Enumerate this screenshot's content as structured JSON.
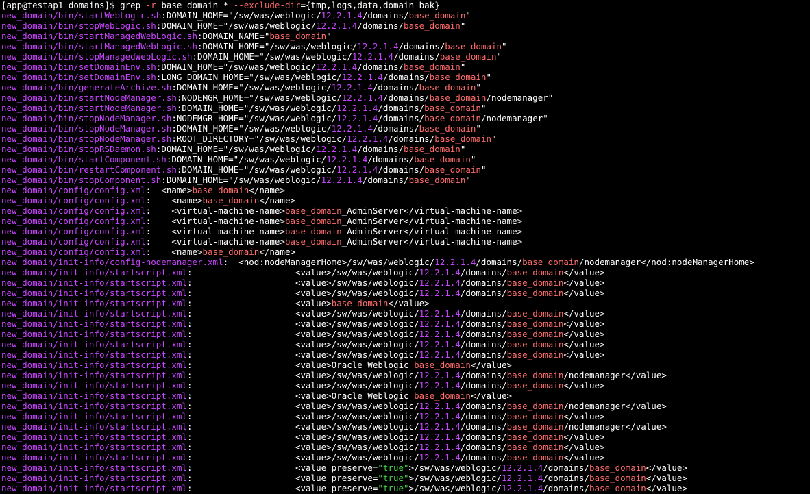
{
  "terminal": {
    "prompt": "[app@testap1 domains]$ ",
    "command_start": "grep ",
    "command_flag_r": "-r",
    "command_mid": " base_domain * ",
    "command_flag_ex": "--exclude-dir",
    "command_end": "={tmp,logs,data,domain_bak}",
    "colors": {
      "background": "#000000",
      "foreground": "#ffffff",
      "filename": "#c845ff",
      "match": "#ff6b6b",
      "string_literal": "#46d146"
    }
  },
  "lines": [
    {
      "file": "new_domain/bin/startWebLogic.sh",
      "pre": "DOMAIN_HOME=\"/sw/was/weblogic/",
      "ver": "12.2.1.4",
      "mid": "/domains/",
      "match": "base_domain",
      "post": "\""
    },
    {
      "file": "new_domain/bin/stopWebLogic.sh",
      "pre": "DOMAIN_HOME=\"/sw/was/weblogic/",
      "ver": "12.2.1.4",
      "mid": "/domains/",
      "match": "base_domain",
      "post": "\""
    },
    {
      "file": "new_domain/bin/startManagedWebLogic.sh",
      "pre": "DOMAIN_NAME=\"",
      "ver": "",
      "mid": "",
      "match": "base_domain",
      "post": "\""
    },
    {
      "file": "new_domain/bin/startManagedWebLogic.sh",
      "pre": "DOMAIN_HOME=\"/sw/was/weblogic/",
      "ver": "12.2.1.4",
      "mid": "/domains/",
      "match": "base_domain",
      "post": "\""
    },
    {
      "file": "new_domain/bin/stopManagedWebLogic.sh",
      "pre": "DOMAIN_HOME=\"/sw/was/weblogic/",
      "ver": "12.2.1.4",
      "mid": "/domains/",
      "match": "base_domain",
      "post": "\""
    },
    {
      "file": "new_domain/bin/setDomainEnv.sh",
      "pre": "DOMAIN_HOME=\"/sw/was/weblogic/",
      "ver": "12.2.1.4",
      "mid": "/domains/",
      "match": "base_domain",
      "post": "\""
    },
    {
      "file": "new_domain/bin/setDomainEnv.sh",
      "pre": "LONG_DOMAIN_HOME=\"/sw/was/weblogic/",
      "ver": "12.2.1.4",
      "mid": "/domains/",
      "match": "base_domain",
      "post": "\""
    },
    {
      "file": "new_domain/bin/generateArchive.sh",
      "pre": "DOMAIN_HOME=\"/sw/was/weblogic/",
      "ver": "12.2.1.4",
      "mid": "/domains/",
      "match": "base_domain",
      "post": "\""
    },
    {
      "file": "new_domain/bin/startNodeManager.sh",
      "pre": "NODEMGR_HOME=\"/sw/was/weblogic/",
      "ver": "12.2.1.4",
      "mid": "/domains/",
      "match": "base_domain",
      "post": "/nodemanager\""
    },
    {
      "file": "new_domain/bin/startNodeManager.sh",
      "pre": "DOMAIN_HOME=\"/sw/was/weblogic/",
      "ver": "12.2.1.4",
      "mid": "/domains/",
      "match": "base_domain",
      "post": "\""
    },
    {
      "file": "new_domain/bin/stopNodeManager.sh",
      "pre": "NODEMGR_HOME=\"/sw/was/weblogic/",
      "ver": "12.2.1.4",
      "mid": "/domains/",
      "match": "base_domain",
      "post": "/nodemanager\""
    },
    {
      "file": "new_domain/bin/stopNodeManager.sh",
      "pre": "DOMAIN_HOME=\"/sw/was/weblogic/",
      "ver": "12.2.1.4",
      "mid": "/domains/",
      "match": "base_domain",
      "post": "\""
    },
    {
      "file": "new_domain/bin/stopNodeManager.sh",
      "pre": "ROOT_DIRECTORY=\"/sw/was/weblogic/",
      "ver": "12.2.1.4",
      "mid": "/domains/",
      "match": "base_domain",
      "post": "\""
    },
    {
      "file": "new_domain/bin/stopRSDaemon.sh",
      "pre": "DOMAIN_HOME=\"/sw/was/weblogic/",
      "ver": "12.2.1.4",
      "mid": "/domains/",
      "match": "base_domain",
      "post": "\""
    },
    {
      "file": "new_domain/bin/startComponent.sh",
      "pre": "DOMAIN_HOME=\"/sw/was/weblogic/",
      "ver": "12.2.1.4",
      "mid": "/domains/",
      "match": "base_domain",
      "post": "\""
    },
    {
      "file": "new_domain/bin/restartComponent.sh",
      "pre": "DOMAIN_HOME=\"/sw/was/weblogic/",
      "ver": "12.2.1.4",
      "mid": "/domains/",
      "match": "base_domain",
      "post": "\""
    },
    {
      "file": "new_domain/bin/stopComponent.sh",
      "pre": "DOMAIN_HOME=\"/sw/was/weblogic/",
      "ver": "12.2.1.4",
      "mid": "/domains/",
      "match": "base_domain",
      "post": "\""
    },
    {
      "file": "new_domain/config/config.xml",
      "pre": "  <name>",
      "ver": "",
      "mid": "",
      "match": "base_domain",
      "post": "</name>"
    },
    {
      "file": "new_domain/config/config.xml",
      "pre": "    <name>",
      "ver": "",
      "mid": "",
      "match": "base_domain",
      "post": "</name>"
    },
    {
      "file": "new_domain/config/config.xml",
      "pre": "    <virtual-machine-name>",
      "ver": "",
      "mid": "",
      "match": "base_domain",
      "post": "_AdminServer</virtual-machine-name>"
    },
    {
      "file": "new_domain/config/config.xml",
      "pre": "    <virtual-machine-name>",
      "ver": "",
      "mid": "",
      "match": "base_domain",
      "post": "_AdminServer</virtual-machine-name>"
    },
    {
      "file": "new_domain/config/config.xml",
      "pre": "    <virtual-machine-name>",
      "ver": "",
      "mid": "",
      "match": "base_domain",
      "post": "_AdminServer</virtual-machine-name>"
    },
    {
      "file": "new_domain/config/config.xml",
      "pre": "    <virtual-machine-name>",
      "ver": "",
      "mid": "",
      "match": "base_domain",
      "post": "_AdminServer</virtual-machine-name>"
    },
    {
      "file": "new_domain/config/config.xml",
      "pre": "    <name>",
      "ver": "",
      "mid": "",
      "match": "base_domain",
      "post": "</name>"
    },
    {
      "file": "new_domain/init-info/config-nodemanager.xml",
      "pre": "  <nod:nodeManagerHome>/sw/was/weblogic/",
      "ver": "12.2.1.4",
      "mid": "/domains/",
      "match": "base_domain",
      "post": "/nodemanager</nod:nodeManagerHome>"
    },
    {
      "file": "new_domain/init-info/startscript.xml",
      "pre": "                    <value>/sw/was/weblogic/",
      "ver": "12.2.1.4",
      "mid": "/domains/",
      "match": "base_domain",
      "post": "</value>"
    },
    {
      "file": "new_domain/init-info/startscript.xml",
      "pre": "                    <value>/sw/was/weblogic/",
      "ver": "12.2.1.4",
      "mid": "/domains/",
      "match": "base_domain",
      "post": "</value>"
    },
    {
      "file": "new_domain/init-info/startscript.xml",
      "pre": "                    <value>/sw/was/weblogic/",
      "ver": "12.2.1.4",
      "mid": "/domains/",
      "match": "base_domain",
      "post": "</value>"
    },
    {
      "file": "new_domain/init-info/startscript.xml",
      "pre": "                    <value>",
      "ver": "",
      "mid": "",
      "match": "base_domain",
      "post": "</value>"
    },
    {
      "file": "new_domain/init-info/startscript.xml",
      "pre": "                    <value>/sw/was/weblogic/",
      "ver": "12.2.1.4",
      "mid": "/domains/",
      "match": "base_domain",
      "post": "</value>"
    },
    {
      "file": "new_domain/init-info/startscript.xml",
      "pre": "                    <value>/sw/was/weblogic/",
      "ver": "12.2.1.4",
      "mid": "/domains/",
      "match": "base_domain",
      "post": "</value>"
    },
    {
      "file": "new_domain/init-info/startscript.xml",
      "pre": "                    <value>/sw/was/weblogic/",
      "ver": "12.2.1.4",
      "mid": "/domains/",
      "match": "base_domain",
      "post": "</value>"
    },
    {
      "file": "new_domain/init-info/startscript.xml",
      "pre": "                    <value>/sw/was/weblogic/",
      "ver": "12.2.1.4",
      "mid": "/domains/",
      "match": "base_domain",
      "post": "</value>"
    },
    {
      "file": "new_domain/init-info/startscript.xml",
      "pre": "                    <value>/sw/was/weblogic/",
      "ver": "12.2.1.4",
      "mid": "/domains/",
      "match": "base_domain",
      "post": "</value>"
    },
    {
      "file": "new_domain/init-info/startscript.xml",
      "pre": "                    <value>Oracle Weblogic ",
      "ver": "",
      "mid": "",
      "match": "base_domain",
      "post": "</value>"
    },
    {
      "file": "new_domain/init-info/startscript.xml",
      "pre": "                    <value>/sw/was/weblogic/",
      "ver": "12.2.1.4",
      "mid": "/domains/",
      "match": "base_domain",
      "post": "/nodemanager</value>"
    },
    {
      "file": "new_domain/init-info/startscript.xml",
      "pre": "                    <value>/sw/was/weblogic/",
      "ver": "12.2.1.4",
      "mid": "/domains/",
      "match": "base_domain",
      "post": "</value>"
    },
    {
      "file": "new_domain/init-info/startscript.xml",
      "pre": "                    <value>Oracle Weblogic ",
      "ver": "",
      "mid": "",
      "match": "base_domain",
      "post": "</value>"
    },
    {
      "file": "new_domain/init-info/startscript.xml",
      "pre": "                    <value>/sw/was/weblogic/",
      "ver": "12.2.1.4",
      "mid": "/domains/",
      "match": "base_domain",
      "post": "/nodemanager</value>"
    },
    {
      "file": "new_domain/init-info/startscript.xml",
      "pre": "                    <value>/sw/was/weblogic/",
      "ver": "12.2.1.4",
      "mid": "/domains/",
      "match": "base_domain",
      "post": "</value>"
    },
    {
      "file": "new_domain/init-info/startscript.xml",
      "pre": "                    <value>/sw/was/weblogic/",
      "ver": "12.2.1.4",
      "mid": "/domains/",
      "match": "base_domain",
      "post": "/nodemanager</value>"
    },
    {
      "file": "new_domain/init-info/startscript.xml",
      "pre": "                    <value>/sw/was/weblogic/",
      "ver": "12.2.1.4",
      "mid": "/domains/",
      "match": "base_domain",
      "post": "</value>"
    },
    {
      "file": "new_domain/init-info/startscript.xml",
      "pre": "                    <value>/sw/was/weblogic/",
      "ver": "12.2.1.4",
      "mid": "/domains/",
      "match": "base_domain",
      "post": "</value>"
    },
    {
      "file": "new_domain/init-info/startscript.xml",
      "pre": "                    <value>/sw/was/weblogic/",
      "ver": "12.2.1.4",
      "mid": "/domains/",
      "match": "base_domain",
      "post": "</value>"
    },
    {
      "file": "new_domain/init-info/startscript.xml",
      "pre": "                    <value preserve=",
      "lit": "\"true\"",
      "pre2": ">/sw/was/weblogic/",
      "ver": "12.2.1.4",
      "mid": "/domains/",
      "match": "base_domain",
      "post": "</value>"
    },
    {
      "file": "new_domain/init-info/startscript.xml",
      "pre": "                    <value preserve=",
      "lit": "\"true\"",
      "pre2": ">/sw/was/weblogic/",
      "ver": "12.2.1.4",
      "mid": "/domains/",
      "match": "base_domain",
      "post": "</value>"
    },
    {
      "file": "new_domain/init-info/startscript.xml",
      "pre": "                    <value preserve=",
      "lit": "\"true\"",
      "pre2": ">/sw/was/weblogic/",
      "ver": "12.2.1.4",
      "mid": "/domains/",
      "match": "base_domain",
      "post": "</value>"
    }
  ]
}
